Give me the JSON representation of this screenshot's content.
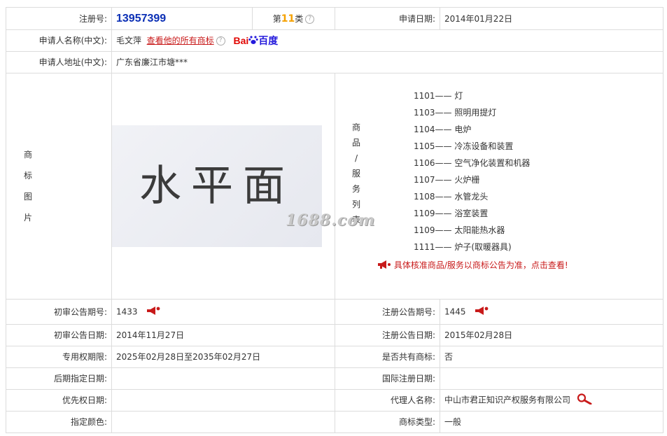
{
  "row1": {
    "reg_label": "注册号:",
    "reg_value": "13957399",
    "class_prefix": "第",
    "class_num": "11",
    "class_suffix": "类",
    "apply_date_label": "申请日期:",
    "apply_date_value": "2014年01月22日"
  },
  "applicant": {
    "name_label": "申请人名称(中文):",
    "name_value": "毛文萍",
    "view_all_link": "查看他的所有商标",
    "baidu_a": "Bai",
    "baidu_b": "百度",
    "addr_label": "申请人地址(中文):",
    "addr_value": "广东省廉江市塘***"
  },
  "trademark": {
    "label_chars": [
      "商",
      "标",
      "图",
      "片"
    ],
    "image_text": "水平面"
  },
  "goods": {
    "label_chars": [
      "商",
      "品",
      "/",
      "服",
      "务",
      "列",
      "表"
    ],
    "items": [
      {
        "code": "1101",
        "name": "灯"
      },
      {
        "code": "1103",
        "name": "照明用提灯"
      },
      {
        "code": "1104",
        "name": "电炉"
      },
      {
        "code": "1105",
        "name": "冷冻设备和装置"
      },
      {
        "code": "1106",
        "name": "空气净化装置和机器"
      },
      {
        "code": "1107",
        "name": "火炉栅"
      },
      {
        "code": "1108",
        "name": "水管龙头"
      },
      {
        "code": "1109",
        "name": "浴室装置"
      },
      {
        "code": "1109",
        "name": "太阳能热水器"
      },
      {
        "code": "1111",
        "name": "炉子(取暖器具)"
      }
    ],
    "dash": "——",
    "notice": "具体核准商品/服务以商标公告为准，点击查看!"
  },
  "watermark": "1688.com",
  "details": {
    "prelim_no_label": "初审公告期号:",
    "prelim_no_value": "1433",
    "reg_pub_no_label": "注册公告期号:",
    "reg_pub_no_value": "1445",
    "prelim_date_label": "初审公告日期:",
    "prelim_date_value": "2014年11月27日",
    "reg_pub_date_label": "注册公告日期:",
    "reg_pub_date_value": "2015年02月28日",
    "term_label": "专用权期限:",
    "term_value": "2025年02月28日至2035年02月27日",
    "shared_label": "是否共有商标:",
    "shared_value": "否",
    "later_label": "后期指定日期:",
    "later_value": "",
    "intl_label": "国际注册日期:",
    "intl_value": "",
    "priority_label": "优先权日期:",
    "priority_value": "",
    "agent_label": "代理人名称:",
    "agent_value": "中山市君正知识产权服务有限公司",
    "color_label": "指定颜色:",
    "color_value": "",
    "type_label": "商标类型:",
    "type_value": "一般"
  },
  "colors": {
    "reg_blue": "#0b2fb5",
    "class_orange": "#f5a100",
    "link_red": "#c81a1a"
  }
}
